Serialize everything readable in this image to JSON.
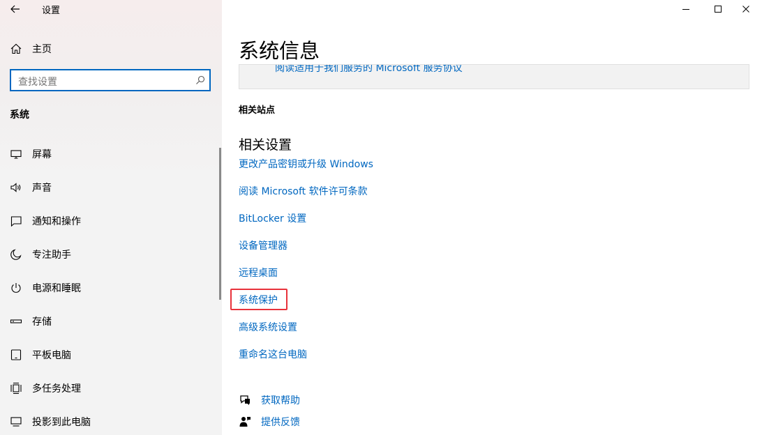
{
  "window": {
    "title": "设置",
    "controls": {
      "minimize": "minimize-icon",
      "maximize": "maximize-icon",
      "close": "close-icon"
    }
  },
  "sidebar": {
    "home_label": "主页",
    "search_placeholder": "查找设置",
    "section_title": "系统",
    "items": [
      {
        "label": "屏幕",
        "icon": "display-icon"
      },
      {
        "label": "声音",
        "icon": "speaker-icon"
      },
      {
        "label": "通知和操作",
        "icon": "notification-icon"
      },
      {
        "label": "专注助手",
        "icon": "moon-icon"
      },
      {
        "label": "电源和睡眠",
        "icon": "power-icon"
      },
      {
        "label": "存储",
        "icon": "storage-icon"
      },
      {
        "label": "平板电脑",
        "icon": "tablet-icon"
      },
      {
        "label": "多任务处理",
        "icon": "multitask-icon"
      },
      {
        "label": "投影到此电脑",
        "icon": "projection-icon"
      }
    ]
  },
  "main": {
    "page_title": "系统信息",
    "card_link": "阅读适用于我们服务的 Microsoft 服务协议",
    "related_sites_title": "相关站点",
    "related_settings_title": "相关设置",
    "related_settings_links": [
      "更改产品密钥或升级 Windows",
      "阅读 Microsoft 软件许可条款",
      "BitLocker 设置",
      "设备管理器",
      "远程桌面",
      "系统保护",
      "高级系统设置",
      "重命名这台电脑"
    ],
    "highlighted_link": "系统保护",
    "highlight_color": "#e8323b",
    "accent_color": "#0067c0",
    "help": [
      {
        "label": "获取帮助",
        "icon": "help-chat-icon"
      },
      {
        "label": "提供反馈",
        "icon": "feedback-icon"
      }
    ]
  }
}
